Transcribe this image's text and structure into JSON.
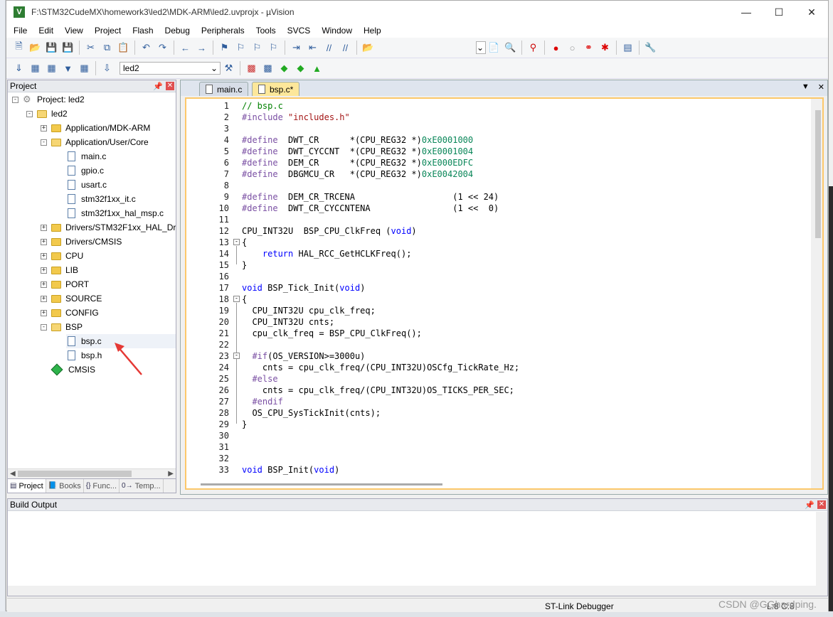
{
  "window": {
    "title": "F:\\STM32CudeMX\\homework3\\led2\\MDK-ARM\\led2.uvprojx - µVision"
  },
  "menu": [
    "File",
    "Edit",
    "View",
    "Project",
    "Flash",
    "Debug",
    "Peripherals",
    "Tools",
    "SVCS",
    "Window",
    "Help"
  ],
  "toolbar2": {
    "target": "led2"
  },
  "project_panel": {
    "title": "Project",
    "project_root": "Project: led2",
    "target": "led2",
    "groups": [
      {
        "label": "Application/MDK-ARM",
        "expanded": false
      },
      {
        "label": "Application/User/Core",
        "expanded": true,
        "files": [
          "main.c",
          "gpio.c",
          "usart.c",
          "stm32f1xx_it.c",
          "stm32f1xx_hal_msp.c"
        ]
      },
      {
        "label": "Drivers/STM32F1xx_HAL_Driv",
        "expanded": false
      },
      {
        "label": "Drivers/CMSIS",
        "expanded": false
      },
      {
        "label": "CPU",
        "expanded": false
      },
      {
        "label": "LIB",
        "expanded": false
      },
      {
        "label": "PORT",
        "expanded": false
      },
      {
        "label": "SOURCE",
        "expanded": false
      },
      {
        "label": "CONFIG",
        "expanded": false
      },
      {
        "label": "BSP",
        "expanded": true,
        "files": [
          "bsp.c",
          "bsp.h"
        ]
      },
      {
        "label": "CMSIS",
        "component": true
      }
    ],
    "bottom_tabs": [
      "Project",
      "Books",
      "Func...",
      "Temp..."
    ]
  },
  "editor": {
    "tabs": [
      "main.c",
      "bsp.c*"
    ],
    "active_tab": "bsp.c*",
    "lines": [
      "// bsp.c",
      "#include \"includes.h\"",
      "",
      "#define  DWT_CR      *(CPU_REG32 *)0xE0001000",
      "#define  DWT_CYCCNT  *(CPU_REG32 *)0xE0001004",
      "#define  DEM_CR      *(CPU_REG32 *)0xE000EDFC",
      "#define  DBGMCU_CR   *(CPU_REG32 *)0xE0042004",
      "",
      "#define  DEM_CR_TRCENA                   (1 << 24)",
      "#define  DWT_CR_CYCCNTENA                (1 <<  0)",
      "",
      "CPU_INT32U  BSP_CPU_ClkFreq (void)",
      "{",
      "    return HAL_RCC_GetHCLKFreq();",
      "}",
      "",
      "void BSP_Tick_Init(void)",
      "{",
      "  CPU_INT32U cpu_clk_freq;",
      "  CPU_INT32U cnts;",
      "  cpu_clk_freq = BSP_CPU_ClkFreq();",
      "",
      "  #if(OS_VERSION>=3000u)",
      "    cnts = cpu_clk_freq/(CPU_INT32U)OSCfg_TickRate_Hz;",
      "  #else",
      "    cnts = cpu_clk_freq/(CPU_INT32U)OS_TICKS_PER_SEC;",
      "  #endif",
      "  OS_CPU_SysTickInit(cnts);",
      "}",
      "",
      "",
      "",
      "void BSP_Init(void)"
    ]
  },
  "build_output": {
    "title": "Build Output"
  },
  "status": {
    "debugger": "ST-Link Debugger",
    "position": "L:8 C:8"
  },
  "watermark": "CSDN @GGhardping."
}
